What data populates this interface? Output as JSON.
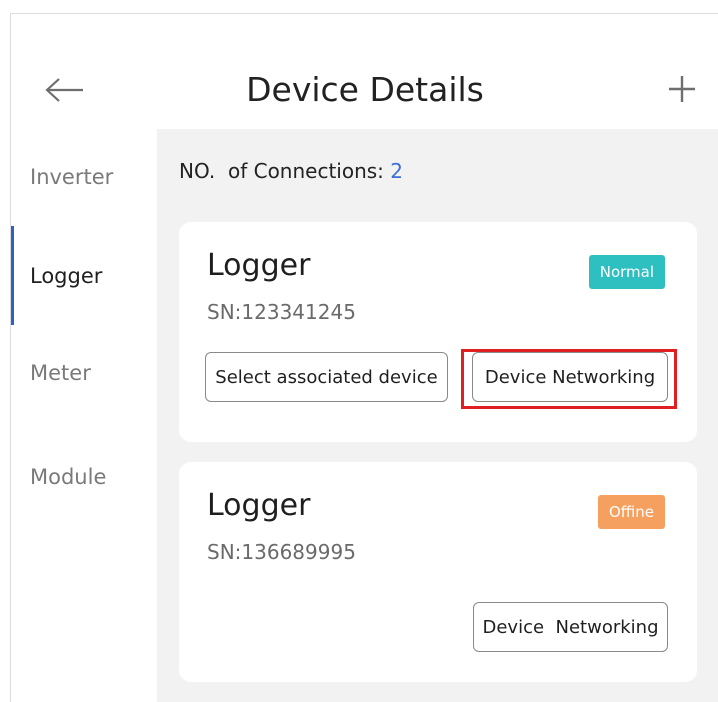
{
  "header": {
    "title": "Device Details",
    "back_icon": "arrow-left-icon",
    "add_icon": "plus-icon"
  },
  "sidebar": {
    "active": "Logger",
    "tabs": [
      {
        "label": "Inverter"
      },
      {
        "label": "Logger"
      },
      {
        "label": "Meter"
      },
      {
        "label": "Module"
      }
    ]
  },
  "main": {
    "connections_label": "NO.  of Connections:",
    "connections_count": "2",
    "devices": [
      {
        "name": "Logger",
        "sn": "SN:123341245",
        "status": "Normal",
        "status_color": "#2ebfc0",
        "buttons": [
          "Select associated device",
          "Device Networking"
        ],
        "highlighted_button": "Device Networking",
        "highlight_color": "#e02020"
      },
      {
        "name": "Logger",
        "sn": "SN:136689995",
        "status": "Offine",
        "status_color": "#f6a060",
        "buttons": [
          "Device  Networking"
        ]
      }
    ]
  },
  "colors": {
    "accent": "#2f60c8",
    "count": "#3b6fd8",
    "panel_bg": "#f2f2f2"
  }
}
